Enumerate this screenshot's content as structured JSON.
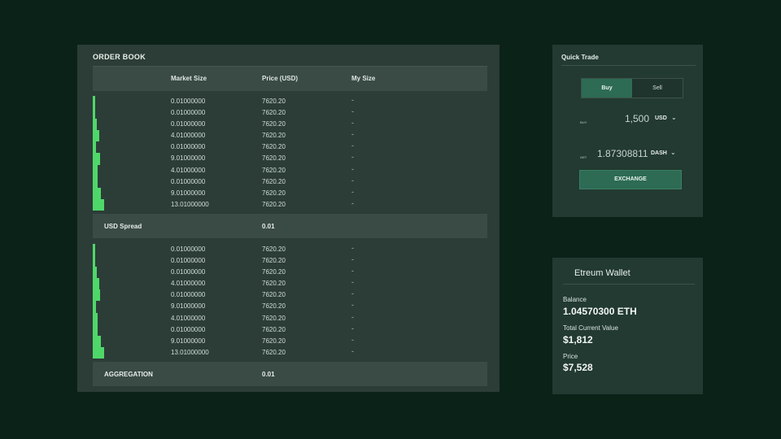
{
  "orderbook": {
    "title": "ORDER BOOK",
    "columns": {
      "market_size": "Market Size",
      "price": "Price (USD)",
      "my_size": "My Size"
    },
    "asks": [
      {
        "size": "0.01000000",
        "price": "7620.20",
        "my": "-",
        "depth": 0.15
      },
      {
        "size": "0.01000000",
        "price": "7620.20",
        "my": "-",
        "depth": 0.2
      },
      {
        "size": "0.01000000",
        "price": "7620.20",
        "my": "-",
        "depth": 0.35
      },
      {
        "size": "4.01000000",
        "price": "7620.20",
        "my": "-",
        "depth": 0.55
      },
      {
        "size": "0.01000000",
        "price": "7620.20",
        "my": "-",
        "depth": 0.3
      },
      {
        "size": "9.01000000",
        "price": "7620.20",
        "my": "-",
        "depth": 0.65
      },
      {
        "size": "4.01000000",
        "price": "7620.20",
        "my": "-",
        "depth": 0.45
      },
      {
        "size": "0.01000000",
        "price": "7620.20",
        "my": "-",
        "depth": 0.4
      },
      {
        "size": "9.01000000",
        "price": "7620.20",
        "my": "-",
        "depth": 0.7
      },
      {
        "size": "13.01000000",
        "price": "7620.20",
        "my": "-",
        "depth": 1.0
      }
    ],
    "spread": {
      "label": "USD Spread",
      "value": "0.01"
    },
    "bids": [
      {
        "size": "0.01000000",
        "price": "7620.20",
        "my": "-",
        "depth": 0.15
      },
      {
        "size": "0.01000000",
        "price": "7620.20",
        "my": "-",
        "depth": 0.2
      },
      {
        "size": "0.01000000",
        "price": "7620.20",
        "my": "-",
        "depth": 0.35
      },
      {
        "size": "4.01000000",
        "price": "7620.20",
        "my": "-",
        "depth": 0.55
      },
      {
        "size": "0.01000000",
        "price": "7620.20",
        "my": "-",
        "depth": 0.65
      },
      {
        "size": "9.01000000",
        "price": "7620.20",
        "my": "-",
        "depth": 0.3
      },
      {
        "size": "4.01000000",
        "price": "7620.20",
        "my": "-",
        "depth": 0.45
      },
      {
        "size": "0.01000000",
        "price": "7620.20",
        "my": "-",
        "depth": 0.4
      },
      {
        "size": "9.01000000",
        "price": "7620.20",
        "my": "-",
        "depth": 0.7
      },
      {
        "size": "13.01000000",
        "price": "7620.20",
        "my": "-",
        "depth": 1.0
      }
    ],
    "aggregation": {
      "label": "AGGREGATION",
      "value": "0.01"
    }
  },
  "quick_trade": {
    "title": "Quick Trade",
    "buy_tab": "Buy",
    "sell_tab": "Sell",
    "buy_tag": "BUY",
    "buy_amount": "1,500",
    "buy_currency": "USD",
    "get_tag": "GET",
    "get_amount": "1.87308811",
    "get_currency": "DASH",
    "chevron": "⌄",
    "exchange_label": "EXCHANGE"
  },
  "wallet": {
    "title": "Etreum Wallet",
    "balance_label": "Balance",
    "balance_value": "1.04570300 ETH",
    "value_label": "Total Current Value",
    "value_value": "$1,812",
    "price_label": "Price",
    "price_value": "$7,528"
  },
  "colors": {
    "background": "#0b2219",
    "panel": "#2c3d37",
    "side_panel": "#223a31",
    "accent": "#2d6b54",
    "depth_bar": "#4fd86a"
  }
}
